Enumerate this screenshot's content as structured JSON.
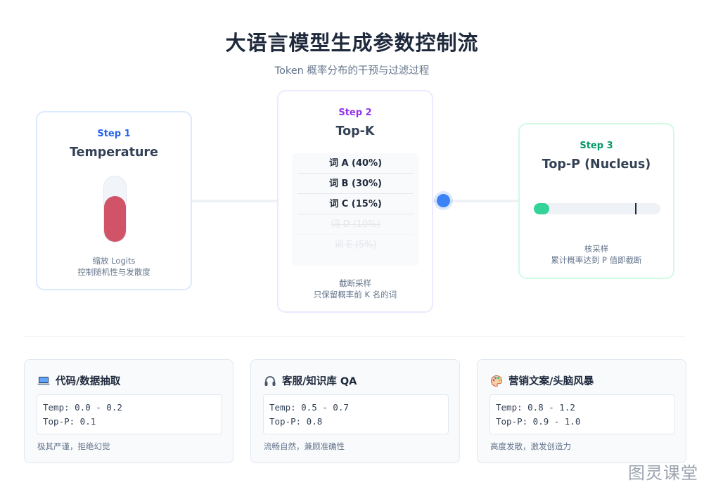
{
  "header": {
    "title": "大语言模型生成参数控制流",
    "subtitle": "Token 概率分布的干预与过滤过程"
  },
  "steps": [
    {
      "label": "Step 1",
      "name": "Temperature",
      "visual": {
        "type": "thermometer",
        "fill_fraction": 0.7
      },
      "desc_line1": "缩放 Logits",
      "desc_line2": "控制随机性与发散度"
    },
    {
      "label": "Step 2",
      "name": "Top-K",
      "tokens": [
        {
          "text": "词 A (40%)",
          "kept": true
        },
        {
          "text": "词 B (30%)",
          "kept": true
        },
        {
          "text": "词 C (15%)",
          "kept": true
        },
        {
          "text": "词 D (10%)",
          "kept": false
        },
        {
          "text": "词 E (5%)",
          "kept": false
        }
      ],
      "desc_line1": "截断采样",
      "desc_line2": "只保留概率前 K 名的词"
    },
    {
      "label": "Step 3",
      "name": "Top-P (Nucleus)",
      "visual": {
        "type": "nucleus-bar",
        "fill_fraction": 0.12,
        "threshold_fraction": 0.8
      },
      "desc_line1": "核采样",
      "desc_line2": "累计概率达到 P 值即截断"
    }
  ],
  "scenarios": [
    {
      "icon": "laptop-icon",
      "title": "代码/数据抽取",
      "param1": "Temp: 0.0 - 0.2",
      "param2": "Top-P: 0.1",
      "note": "极其严谨，拒绝幻觉"
    },
    {
      "icon": "headphones-icon",
      "title": "客服/知识库 QA",
      "param1": "Temp: 0.5 - 0.7",
      "param2": "Top-P: 0.8",
      "note": "流畅自然，兼顾准确性"
    },
    {
      "icon": "palette-icon",
      "title": "营销文案/头脑风暴",
      "param1": "Temp: 0.8 - 1.2",
      "param2": "Top-P: 0.9 - 1.0",
      "note": "高度发散，激发创造力"
    }
  ],
  "watermark": "图灵课堂",
  "colors": {
    "step1": "#2563eb",
    "step2": "#9333ea",
    "step3": "#059669",
    "thermometer": "#d05368",
    "nucleus": "#34d399",
    "flow_dot": "#3b82f6"
  }
}
